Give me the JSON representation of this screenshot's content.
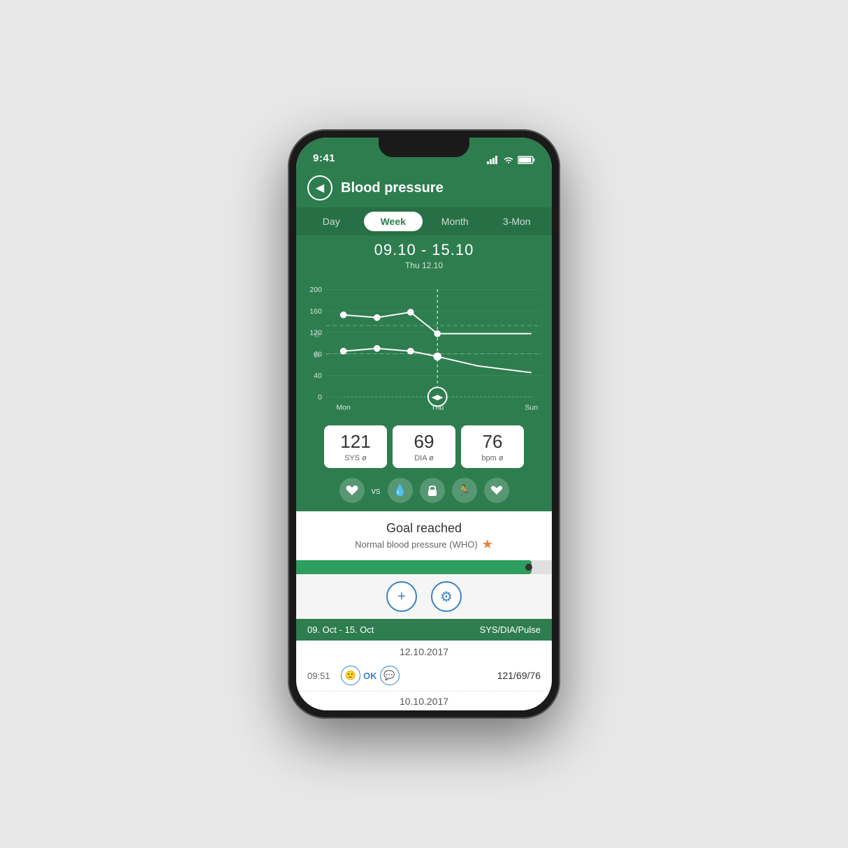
{
  "status_bar": {
    "time": "9:41",
    "icons": "●●●● ▲ ▬"
  },
  "header": {
    "title": "Blood pressure",
    "back_label": "◀"
  },
  "tabs": [
    {
      "label": "Day",
      "active": false
    },
    {
      "label": "Week",
      "active": true
    },
    {
      "label": "Month",
      "active": false
    },
    {
      "label": "3-Mon",
      "active": false
    }
  ],
  "chart": {
    "date_range": "09.10 - 15.10",
    "date_sub": "Thu 12.10",
    "y_labels": [
      "200",
      "160",
      "120",
      "80",
      "40",
      "0"
    ],
    "x_labels": [
      "Mon",
      "Thu",
      "Sun"
    ]
  },
  "stats": [
    {
      "value": "121",
      "label": "SYS ø"
    },
    {
      "value": "69",
      "label": "DIA ø"
    },
    {
      "value": "76",
      "label": "bpm ø"
    }
  ],
  "vs_label": "vs",
  "goal": {
    "title": "Goal reached",
    "subtitle": "Normal blood pressure (WHO)",
    "star": "★"
  },
  "progress": {
    "fill_percent": 92
  },
  "actions": [
    {
      "icon": "+",
      "name": "add-button"
    },
    {
      "icon": "⚙",
      "name": "settings-button"
    }
  ],
  "list_header": {
    "date_range": "09. Oct - 15. Oct",
    "columns": "SYS/DIA/Pulse"
  },
  "entries": [
    {
      "date": "12.10.2017",
      "rows": [
        {
          "time": "09:51",
          "status": "OK",
          "value": "121/69/76"
        }
      ]
    },
    {
      "date": "10.10.2017",
      "rows": []
    }
  ],
  "colors": {
    "green_primary": "#2e7d4f",
    "green_dark": "#277045",
    "blue_accent": "#3b82c4",
    "orange_star": "#e8813a"
  }
}
